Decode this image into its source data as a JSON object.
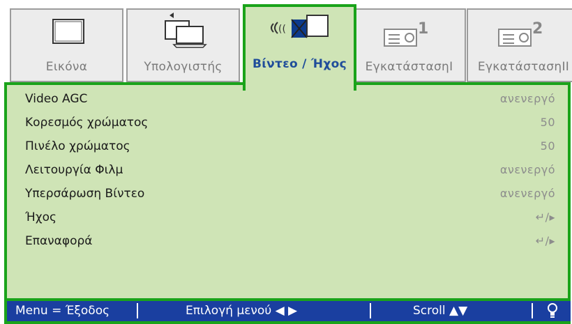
{
  "tabs": [
    {
      "label": "Εικόνα",
      "icon": "monitor-icon",
      "active": false
    },
    {
      "label": "Υπολογιστής",
      "icon": "computer-icon",
      "active": false
    },
    {
      "label": "Βίντεο / Ήχος",
      "icon": "video-audio-icon",
      "active": true
    },
    {
      "label": "ΕγκατάστασηΙ",
      "icon": "projector-setup-1-icon",
      "active": false
    },
    {
      "label": "ΕγκατάστασηΙΙ",
      "icon": "projector-setup-2-icon",
      "active": false
    }
  ],
  "settings": [
    {
      "label": "Video AGC",
      "value": "ανενεργό"
    },
    {
      "label": "Κορεσμός χρώματος",
      "value": "50"
    },
    {
      "label": "Πινέλο χρώματος",
      "value": "50"
    },
    {
      "label": "Λειτουργία Φιλμ",
      "value": "ανενεργό"
    },
    {
      "label": "Υπερσάρωση Βίντεο",
      "value": "ανενεργό"
    },
    {
      "label": "Ήχος",
      "value": "↵/▸"
    },
    {
      "label": "Επαναφορά",
      "value": "↵/▸"
    }
  ],
  "footer": {
    "menu_exit": "Menu = Έξοδος",
    "select_menu": "Επιλογή μενού ◀ ▶",
    "scroll": "Scroll ▲▼",
    "bulb_icon": "bulb-icon"
  },
  "colors": {
    "border_green": "#1aa31a",
    "panel_green": "#cfe4b6",
    "footer_blue": "#1a3fa0",
    "active_label": "#1f4d9a"
  }
}
